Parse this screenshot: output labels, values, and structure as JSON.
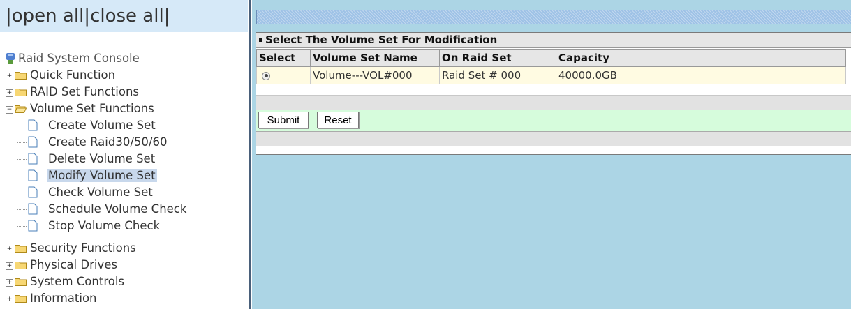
{
  "nav": {
    "open_all": "open all",
    "close_all": "close all",
    "sep": "|",
    "root": "Raid System Console",
    "items": [
      {
        "label": "Quick Function"
      },
      {
        "label": "RAID Set Functions"
      },
      {
        "label": "Volume Set Functions"
      },
      {
        "label": "Security Functions"
      },
      {
        "label": "Physical Drives"
      },
      {
        "label": "System Controls"
      },
      {
        "label": "Information"
      }
    ],
    "volume_children": [
      {
        "label": "Create Volume Set"
      },
      {
        "label": "Create Raid30/50/60"
      },
      {
        "label": "Delete Volume Set"
      },
      {
        "label": "Modify Volume Set"
      },
      {
        "label": "Check Volume Set"
      },
      {
        "label": "Schedule Volume Check"
      },
      {
        "label": "Stop Volume Check"
      }
    ]
  },
  "panel": {
    "title": "Select The Volume Set For Modification",
    "columns": [
      "Select",
      "Volume Set Name",
      "On Raid Set",
      "Capacity"
    ],
    "rows": [
      {
        "name": "Volume---VOL#000",
        "raid_set": "Raid Set # 000",
        "capacity": "40000.0GB"
      }
    ],
    "submit_label": "Submit",
    "reset_label": "Reset"
  }
}
